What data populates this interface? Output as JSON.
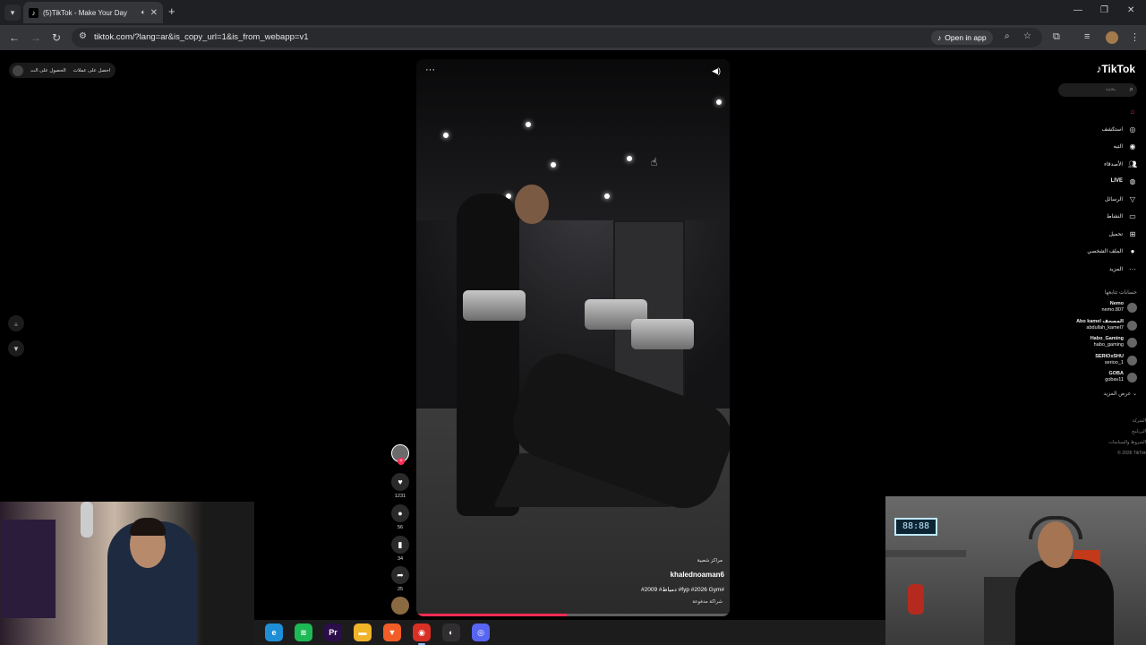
{
  "browser": {
    "tab_title": "(5)TikTok - Make Your Day",
    "url": "tiktok.com/?lang=ar&is_copy_url=1&is_from_webapp=v1",
    "open_in_app": "Open in app"
  },
  "top_bar": {
    "get_coins": "احصل على عملات",
    "get_app": "الحصول على الت"
  },
  "video": {
    "author": "khalednoaman6",
    "badge": "مراكز شعبية",
    "caption": "#2009 #دمياط #fyp #2026 Gym#",
    "partnership": "شراكة مدفوعة",
    "progress_percent": 48
  },
  "actions": {
    "likes": "1231",
    "comments": "56",
    "saves": "34",
    "shares": "25"
  },
  "sidebar": {
    "logo": "TikTok",
    "search_placeholder": "بحث",
    "nav": [
      {
        "label": "",
        "icon": "home-icon"
      },
      {
        "label": "استكشف",
        "icon": "compass-icon"
      },
      {
        "label": "التيه",
        "icon": "following-icon"
      },
      {
        "label": "الأصدقاء",
        "icon": "friends-icon"
      },
      {
        "label": "LIVE",
        "icon": "live-icon"
      },
      {
        "label": "الرسائل",
        "icon": "messages-icon"
      },
      {
        "label": "النشاط",
        "icon": "activity-icon"
      },
      {
        "label": "تحميل",
        "icon": "upload-icon"
      },
      {
        "label": "الملف الشخصي",
        "icon": "profile-icon"
      },
      {
        "label": "المزيد",
        "icon": "more-icon"
      }
    ],
    "following_title": "حسابات تتابعها",
    "following": [
      {
        "name": "Nemo",
        "handle": "nemo.807"
      },
      {
        "name": "Abo kamel المصحف",
        "handle": "abdullah_kamel7"
      },
      {
        "name": "Habo_Gaming",
        "handle": "habo_gaming"
      },
      {
        "name": "SERIOxSHU",
        "handle": "serioo_1"
      },
      {
        "name": "GOBA",
        "handle": "gobav11"
      }
    ],
    "see_more": "عرض المزيد",
    "footer": [
      "الشركة",
      "البرنامج",
      "الشروط والسياسات",
      "© 2026 TikTok"
    ]
  },
  "webcam_right": {
    "clock": "88:88"
  },
  "taskbar": {
    "apps": [
      {
        "name": "edge",
        "color": "#1e8fd6",
        "glyph": "e"
      },
      {
        "name": "spotify",
        "color": "#1db954",
        "glyph": "≋"
      },
      {
        "name": "premiere",
        "color": "#2b0d4a",
        "glyph": "Pr"
      },
      {
        "name": "files",
        "color": "#f0b429",
        "glyph": "▬"
      },
      {
        "name": "brave",
        "color": "#f25c26",
        "glyph": "▼"
      },
      {
        "name": "chrome",
        "color": "#d93025",
        "glyph": "◉"
      },
      {
        "name": "obs",
        "color": "#302e31",
        "glyph": "◐"
      },
      {
        "name": "discord",
        "color": "#5865f2",
        "glyph": "◎"
      }
    ]
  }
}
